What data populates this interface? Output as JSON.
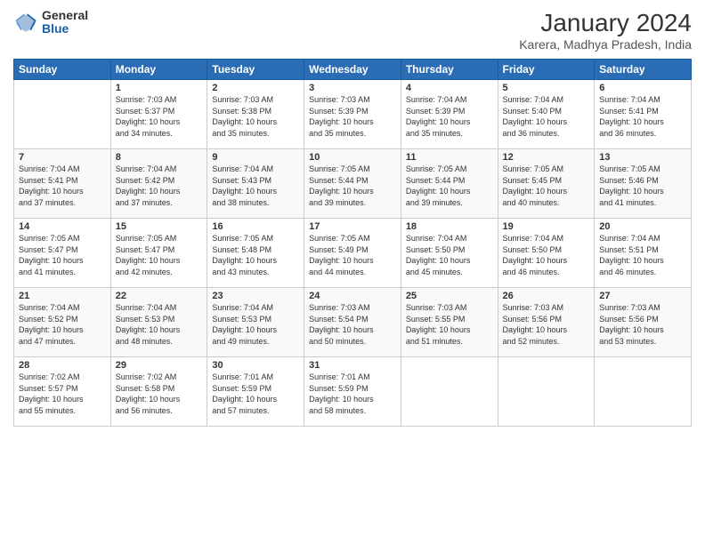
{
  "logo": {
    "general": "General",
    "blue": "Blue"
  },
  "title": "January 2024",
  "subtitle": "Karera, Madhya Pradesh, India",
  "headers": [
    "Sunday",
    "Monday",
    "Tuesday",
    "Wednesday",
    "Thursday",
    "Friday",
    "Saturday"
  ],
  "weeks": [
    [
      {
        "day": "",
        "info": ""
      },
      {
        "day": "1",
        "info": "Sunrise: 7:03 AM\nSunset: 5:37 PM\nDaylight: 10 hours\nand 34 minutes."
      },
      {
        "day": "2",
        "info": "Sunrise: 7:03 AM\nSunset: 5:38 PM\nDaylight: 10 hours\nand 35 minutes."
      },
      {
        "day": "3",
        "info": "Sunrise: 7:03 AM\nSunset: 5:39 PM\nDaylight: 10 hours\nand 35 minutes."
      },
      {
        "day": "4",
        "info": "Sunrise: 7:04 AM\nSunset: 5:39 PM\nDaylight: 10 hours\nand 35 minutes."
      },
      {
        "day": "5",
        "info": "Sunrise: 7:04 AM\nSunset: 5:40 PM\nDaylight: 10 hours\nand 36 minutes."
      },
      {
        "day": "6",
        "info": "Sunrise: 7:04 AM\nSunset: 5:41 PM\nDaylight: 10 hours\nand 36 minutes."
      }
    ],
    [
      {
        "day": "7",
        "info": "Sunrise: 7:04 AM\nSunset: 5:41 PM\nDaylight: 10 hours\nand 37 minutes."
      },
      {
        "day": "8",
        "info": "Sunrise: 7:04 AM\nSunset: 5:42 PM\nDaylight: 10 hours\nand 37 minutes."
      },
      {
        "day": "9",
        "info": "Sunrise: 7:04 AM\nSunset: 5:43 PM\nDaylight: 10 hours\nand 38 minutes."
      },
      {
        "day": "10",
        "info": "Sunrise: 7:05 AM\nSunset: 5:44 PM\nDaylight: 10 hours\nand 39 minutes."
      },
      {
        "day": "11",
        "info": "Sunrise: 7:05 AM\nSunset: 5:44 PM\nDaylight: 10 hours\nand 39 minutes."
      },
      {
        "day": "12",
        "info": "Sunrise: 7:05 AM\nSunset: 5:45 PM\nDaylight: 10 hours\nand 40 minutes."
      },
      {
        "day": "13",
        "info": "Sunrise: 7:05 AM\nSunset: 5:46 PM\nDaylight: 10 hours\nand 41 minutes."
      }
    ],
    [
      {
        "day": "14",
        "info": "Sunrise: 7:05 AM\nSunset: 5:47 PM\nDaylight: 10 hours\nand 41 minutes."
      },
      {
        "day": "15",
        "info": "Sunrise: 7:05 AM\nSunset: 5:47 PM\nDaylight: 10 hours\nand 42 minutes."
      },
      {
        "day": "16",
        "info": "Sunrise: 7:05 AM\nSunset: 5:48 PM\nDaylight: 10 hours\nand 43 minutes."
      },
      {
        "day": "17",
        "info": "Sunrise: 7:05 AM\nSunset: 5:49 PM\nDaylight: 10 hours\nand 44 minutes."
      },
      {
        "day": "18",
        "info": "Sunrise: 7:04 AM\nSunset: 5:50 PM\nDaylight: 10 hours\nand 45 minutes."
      },
      {
        "day": "19",
        "info": "Sunrise: 7:04 AM\nSunset: 5:50 PM\nDaylight: 10 hours\nand 46 minutes."
      },
      {
        "day": "20",
        "info": "Sunrise: 7:04 AM\nSunset: 5:51 PM\nDaylight: 10 hours\nand 46 minutes."
      }
    ],
    [
      {
        "day": "21",
        "info": "Sunrise: 7:04 AM\nSunset: 5:52 PM\nDaylight: 10 hours\nand 47 minutes."
      },
      {
        "day": "22",
        "info": "Sunrise: 7:04 AM\nSunset: 5:53 PM\nDaylight: 10 hours\nand 48 minutes."
      },
      {
        "day": "23",
        "info": "Sunrise: 7:04 AM\nSunset: 5:53 PM\nDaylight: 10 hours\nand 49 minutes."
      },
      {
        "day": "24",
        "info": "Sunrise: 7:03 AM\nSunset: 5:54 PM\nDaylight: 10 hours\nand 50 minutes."
      },
      {
        "day": "25",
        "info": "Sunrise: 7:03 AM\nSunset: 5:55 PM\nDaylight: 10 hours\nand 51 minutes."
      },
      {
        "day": "26",
        "info": "Sunrise: 7:03 AM\nSunset: 5:56 PM\nDaylight: 10 hours\nand 52 minutes."
      },
      {
        "day": "27",
        "info": "Sunrise: 7:03 AM\nSunset: 5:56 PM\nDaylight: 10 hours\nand 53 minutes."
      }
    ],
    [
      {
        "day": "28",
        "info": "Sunrise: 7:02 AM\nSunset: 5:57 PM\nDaylight: 10 hours\nand 55 minutes."
      },
      {
        "day": "29",
        "info": "Sunrise: 7:02 AM\nSunset: 5:58 PM\nDaylight: 10 hours\nand 56 minutes."
      },
      {
        "day": "30",
        "info": "Sunrise: 7:01 AM\nSunset: 5:59 PM\nDaylight: 10 hours\nand 57 minutes."
      },
      {
        "day": "31",
        "info": "Sunrise: 7:01 AM\nSunset: 5:59 PM\nDaylight: 10 hours\nand 58 minutes."
      },
      {
        "day": "",
        "info": ""
      },
      {
        "day": "",
        "info": ""
      },
      {
        "day": "",
        "info": ""
      }
    ]
  ]
}
